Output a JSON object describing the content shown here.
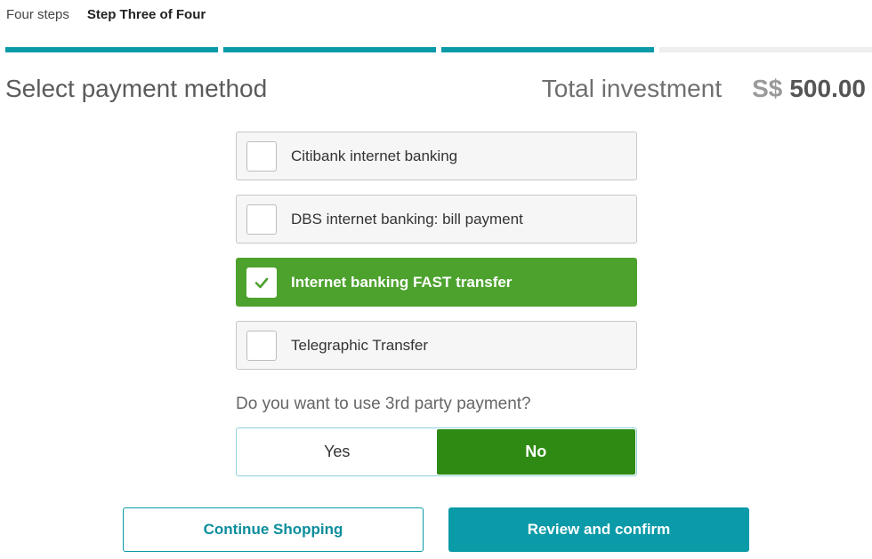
{
  "steps": {
    "label": "Four steps",
    "current": "Step Three of Four",
    "total": 4,
    "completed": 3
  },
  "page": {
    "title": "Select payment method",
    "total_label": "Total investment",
    "currency": "S$",
    "amount": "500.00"
  },
  "payment_options": [
    {
      "label": "Citibank internet banking",
      "selected": false
    },
    {
      "label": "DBS internet banking: bill payment",
      "selected": false
    },
    {
      "label": "Internet banking FAST transfer",
      "selected": true
    },
    {
      "label": "Telegraphic Transfer",
      "selected": false
    }
  ],
  "third_party": {
    "question": "Do you want to use 3rd party payment?",
    "yes_label": "Yes",
    "no_label": "No",
    "selected": "No"
  },
  "actions": {
    "continue_label": "Continue Shopping",
    "review_label": "Review and confirm"
  },
  "colors": {
    "accent": "#0a9aa8",
    "selected_option": "#4da22e",
    "toggle_selected": "#2e8a12"
  },
  "icons": {
    "check": "check-icon"
  }
}
